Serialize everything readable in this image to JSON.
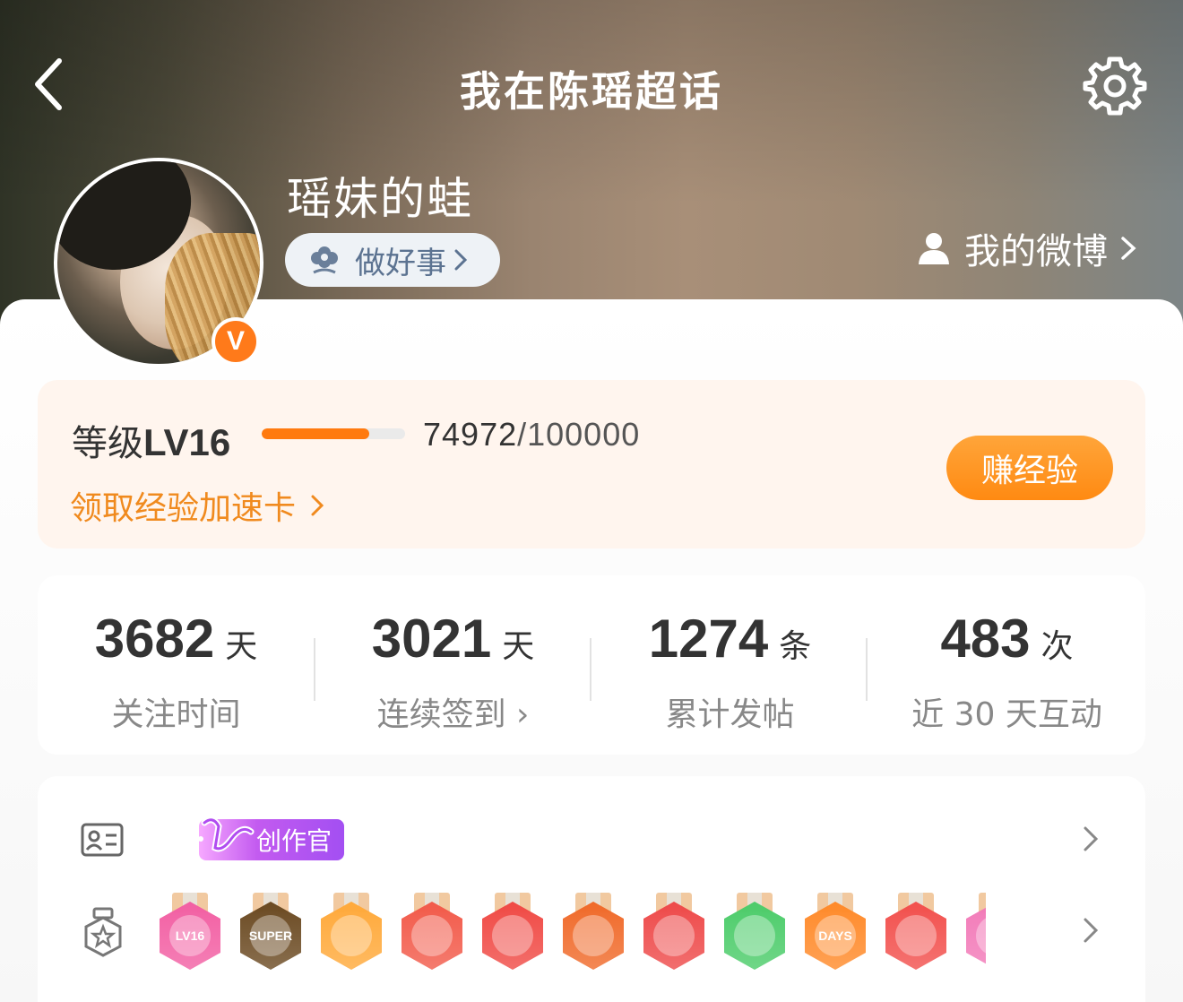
{
  "header": {
    "title": "我在陈瑶超话",
    "username": "瑶妹的蛙",
    "good_deed_label": "做好事",
    "my_weibo_label": "我的微博"
  },
  "level": {
    "label_prefix": "等级",
    "level": "LV16",
    "exp_current": "74972",
    "exp_max": "/100000",
    "progress": 0.7497,
    "speed_card_label": "领取经验加速卡",
    "earn_button_label": "赚经验"
  },
  "stats": [
    {
      "value": "3682",
      "unit": "天",
      "label": "关注时间"
    },
    {
      "value": "3021",
      "unit": "天",
      "label": "连续签到 ›"
    },
    {
      "value": "1274",
      "unit": "条",
      "label": "累计发帖"
    },
    {
      "value": "483",
      "unit": "次",
      "label": "近 30 天互动"
    }
  ],
  "identity": {
    "tag_label": "创作官"
  },
  "medals": [
    {
      "name": "lv16-medal",
      "text": "LV16",
      "color": "#f25fa3"
    },
    {
      "name": "super-medal",
      "text": "SUPER",
      "color": "#6b4a22"
    },
    {
      "name": "crown-medal",
      "text": "",
      "color": "#ffa93a"
    },
    {
      "name": "dragon-medal-1",
      "text": "",
      "color": "#f25a4a"
    },
    {
      "name": "dragon-medal-2",
      "text": "",
      "color": "#f04a45"
    },
    {
      "name": "dragon-medal-3",
      "text": "",
      "color": "#f06a2a"
    },
    {
      "name": "rabbit-medal",
      "text": "",
      "color": "#ee4a4a"
    },
    {
      "name": "hand-medal",
      "text": "",
      "color": "#4ccc6a"
    },
    {
      "name": "100-days-medal",
      "text": "DAYS",
      "color": "#ff8a2a"
    },
    {
      "name": "trophy-medal",
      "text": "",
      "color": "#f2504d"
    },
    {
      "name": "partial-medal",
      "text": "",
      "color": "#f27ab8"
    }
  ],
  "colors": {
    "accent_orange": "#ff7a0f",
    "creator_purple": "#a34ff2",
    "verified_badge": "#ff7a1a"
  }
}
